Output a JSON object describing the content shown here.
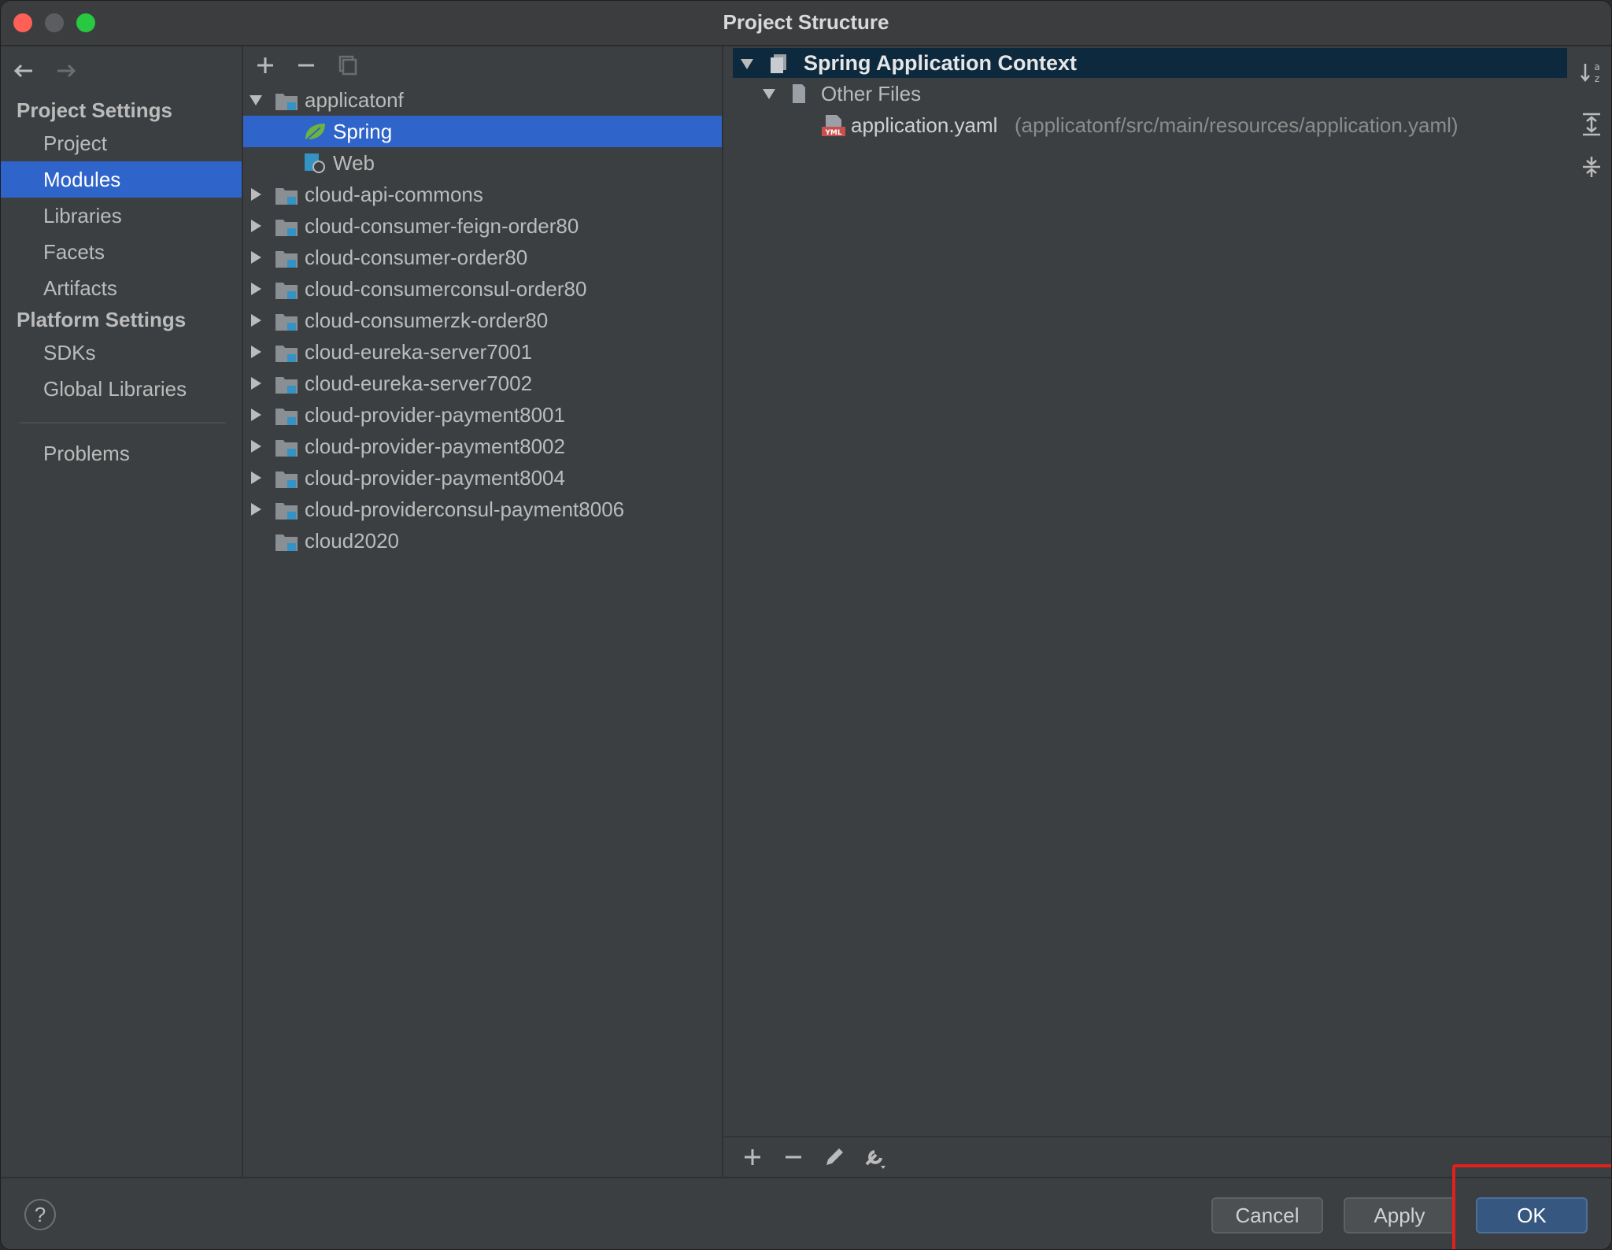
{
  "window": {
    "title": "Project Structure"
  },
  "sidebar": {
    "sections": [
      {
        "label": "Project Settings",
        "items": [
          "Project",
          "Modules",
          "Libraries",
          "Facets",
          "Artifacts"
        ]
      },
      {
        "label": "Platform Settings",
        "items": [
          "SDKs",
          "Global Libraries"
        ]
      }
    ],
    "problems": "Problems",
    "selected": "Modules"
  },
  "tree": {
    "root": "applicatonf",
    "children": [
      {
        "label": "Spring",
        "icon": "spring-leaf-icon",
        "selected": true
      },
      {
        "label": "Web",
        "icon": "web-icon"
      }
    ],
    "modules": [
      "cloud-api-commons",
      "cloud-consumer-feign-order80",
      "cloud-consumer-order80",
      "cloud-consumerconsul-order80",
      "cloud-consumerzk-order80",
      "cloud-eureka-server7001",
      "cloud-eureka-server7002",
      "cloud-provider-payment8001",
      "cloud-provider-payment8002",
      "cloud-provider-payment8004",
      "cloud-providerconsul-payment8006"
    ],
    "last": "cloud2020"
  },
  "context": {
    "title": "Spring Application Context",
    "group": "Other Files",
    "file": "application.yaml",
    "file_path": "(applicatonf/src/main/resources/application.yaml)"
  },
  "footer": {
    "help": "?",
    "cancel": "Cancel",
    "apply": "Apply",
    "ok": "OK"
  },
  "colors": {
    "selection": "#2f65ca",
    "context_header": "#0d293e",
    "highlight": "#e0211c"
  }
}
